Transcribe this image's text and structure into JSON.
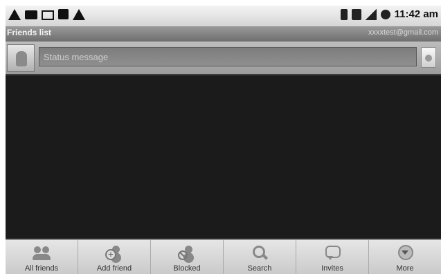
{
  "status_bar": {
    "left_icons": [
      "warning-icon",
      "chat-icon",
      "mail-icon",
      "usb-icon",
      "warning-icon"
    ],
    "right_icons": [
      "bluetooth-icon",
      "sim-icon",
      "signal-icon",
      "battery-icon"
    ],
    "time": "11:42 am"
  },
  "title_bar": {
    "title": "Friends list",
    "account": "xxxxtest@gmail.com"
  },
  "status_row": {
    "placeholder": "Status message",
    "avatar_icon": "android-avatar-icon",
    "presence_icon": "presence-toggle-icon"
  },
  "menu": {
    "items": [
      {
        "label": "All friends",
        "icon": "friends-icon"
      },
      {
        "label": "Add friend",
        "icon": "add-friend-icon"
      },
      {
        "label": "Blocked",
        "icon": "blocked-icon"
      },
      {
        "label": "Search",
        "icon": "search-icon"
      },
      {
        "label": "Invites",
        "icon": "invites-icon"
      },
      {
        "label": "More",
        "icon": "more-icon"
      }
    ]
  },
  "colors": {
    "list_background": "#1b1b1b",
    "title_bar": "#7e7e7e",
    "menu_background": "#d9d9d9"
  }
}
